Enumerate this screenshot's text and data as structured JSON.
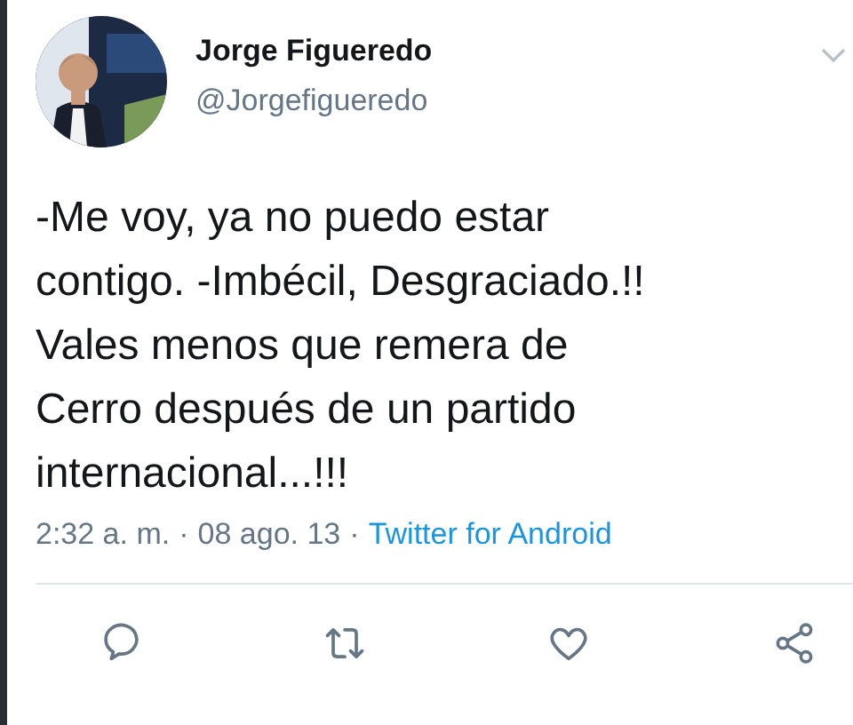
{
  "tweet": {
    "author": {
      "name": "Jorge Figueredo",
      "handle": "@Jorgefigueredo"
    },
    "text_lines": [
      "-Me voy, ya no puedo estar",
      "contigo. -Imbécil, Desgraciado.!!",
      "Vales menos que remera de",
      "Cerro después de un partido",
      "internacional...!!!"
    ],
    "time": "2:32 a. m.",
    "separator": "·",
    "date": "08 ago. 13",
    "source": "Twitter for Android"
  }
}
